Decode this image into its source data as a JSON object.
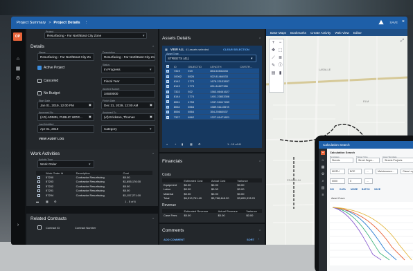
{
  "topbar": {
    "crumb1": "Project Summary",
    "sep": ">",
    "crumb2": "Project Details",
    "save": "SAVE"
  },
  "nav": {
    "logo": "OP"
  },
  "project_field": {
    "label": "Project",
    "value": "Resurfacing - Far NorthEast City Zone"
  },
  "details": {
    "title": "Details",
    "name_label": "Name",
    "name_value": "Resurfacing - Far NorthEast City Zo",
    "desc_label": "Description",
    "desc_value": "Resurfacing - Far NorthEast City Zo",
    "active_label": "Active Project",
    "status_label": "Status",
    "status_value": "In Progress",
    "canceled_label": "Canceled",
    "fiscal_value": "Fiscal Year",
    "nobudget_label": "No Budget",
    "budget_label": "Allotted Budget",
    "budget_value": "34500000",
    "start_label": "Start Date",
    "start_value": "Jan 01, 2019, 12:00 PM",
    "finish_label": "Finish Date",
    "finish_value": "Dec 31, 2029, 12:00 AM",
    "approved_label": "Approved By",
    "approved_value": "(AD) ADMIN, PUBLIC WOR...",
    "assigned_label": "Assigned To",
    "assigned_value": "(vf) Erickson, Thomas",
    "lastmod_label": "Last Modified",
    "lastmod_value": "Apr 01, 2019",
    "category_value": "Category",
    "audit_link": "VIEW AUDIT LOG"
  },
  "work": {
    "title": "Work Activities",
    "type_label": "Activity Type",
    "type_value": "Work Order",
    "headers": [
      "Work Order Id",
      "Description",
      "Cost"
    ],
    "rows": [
      [
        "57200",
        "Contractor Resurfacing",
        "$0.00"
      ],
      [
        "57203",
        "Contractor Resurfacing",
        "$1,655,176.00"
      ],
      [
        "57202",
        "Contractor Resurfacing",
        "$0.00"
      ],
      [
        "57201",
        "Contractor Resurfacing",
        "$0.00"
      ],
      [
        "57204",
        "Contractor Resurfacing",
        "$1,157,271.00"
      ]
    ],
    "pager": "1 - 5 of 6"
  },
  "contracts": {
    "title": "Related Contracts",
    "headers": [
      "Contract ID",
      "Contract Number"
    ]
  },
  "assets": {
    "title": "Assets Details",
    "viewall": "VIEW ALL",
    "selected": "41 assets selected",
    "clear": "CLEAR SELECTION",
    "type_label": "Asset Type",
    "type_value": "STREETS (41)",
    "headers": [
      "ID",
      "OBJECTID",
      "LENGTH",
      "CWSTR..."
    ],
    "rows": [
      [
        "7319",
        "919",
        "854.54531633"
      ],
      [
        "10062",
        "6526",
        "922.81464533"
      ],
      [
        "8142",
        "1773",
        "1678.23133837"
      ],
      [
        "8143",
        "1773",
        "651.84827386"
      ],
      [
        "7322",
        "922",
        "1563.86461627"
      ],
      [
        "8144",
        "1774",
        "1401.23833306"
      ],
      [
        "8061",
        "4753",
        "1337.51617289"
      ],
      [
        "8062",
        "6564",
        "1589.51113578"
      ],
      [
        "8066",
        "6564",
        "354.25660537"
      ],
      [
        "7327",
        "6562",
        "1227.81471821"
      ]
    ],
    "pager": "1 - 10 of 41"
  },
  "financials": {
    "title": "Financials",
    "costs_title": "Costs",
    "cost_headers": [
      "",
      "Estimated Cost",
      "Actual Cost",
      "Variance"
    ],
    "cost_rows": [
      [
        "Equipment",
        "$0.00",
        "$0.00",
        "$0.00"
      ],
      [
        "Labor",
        "$0.00",
        "$0.00",
        "$0.00"
      ],
      [
        "Material",
        "$0.00",
        "$0.00",
        "$0.00"
      ],
      [
        "Total",
        "$6,313,761.40",
        "$3,768,448.20",
        "$3,653,313.20"
      ]
    ],
    "revenue_title": "Revenue",
    "rev_headers": [
      "",
      "Estimated Revenue",
      "Actual Revenue",
      "Variance"
    ],
    "rev_rows": [
      [
        "Case Fees",
        "$0.00",
        "$0.00",
        "$0.00"
      ]
    ]
  },
  "comments": {
    "title": "Comments",
    "add": "ADD COMMENT",
    "sort": "SORT"
  },
  "map": {
    "tabs": [
      "Base Maps",
      "Bookmarks",
      "Create Activity",
      "Web View",
      "Editor"
    ],
    "street_labels": [
      "LASALLE",
      "ELM",
      "FRANKLIN"
    ]
  },
  "tablet": {
    "title": "Calculation Search",
    "subtitle": "Calculation Search",
    "f1_label": "Templates",
    "f1_value": "Streets",
    "f2_label": "Trigger Type",
    "f2_value": "Street Segm...",
    "f3_label": "Asset Template",
    "f3_value": "Streets Projects",
    "row2": [
      "MOPU",
      "BCE",
      "...",
      "Maintenance...",
      "Class Log..."
    ],
    "row3": [
      "0000",
      "0",
      "..."
    ],
    "tabs": [
      "GIS",
      "DATA",
      "MORE",
      "BATCH",
      "SAVE"
    ],
    "chart_title": "Asset Curve"
  },
  "colors": {
    "accent": "#1e5fa8",
    "selection": "#1c4f8a",
    "logo": "#e8643a"
  }
}
